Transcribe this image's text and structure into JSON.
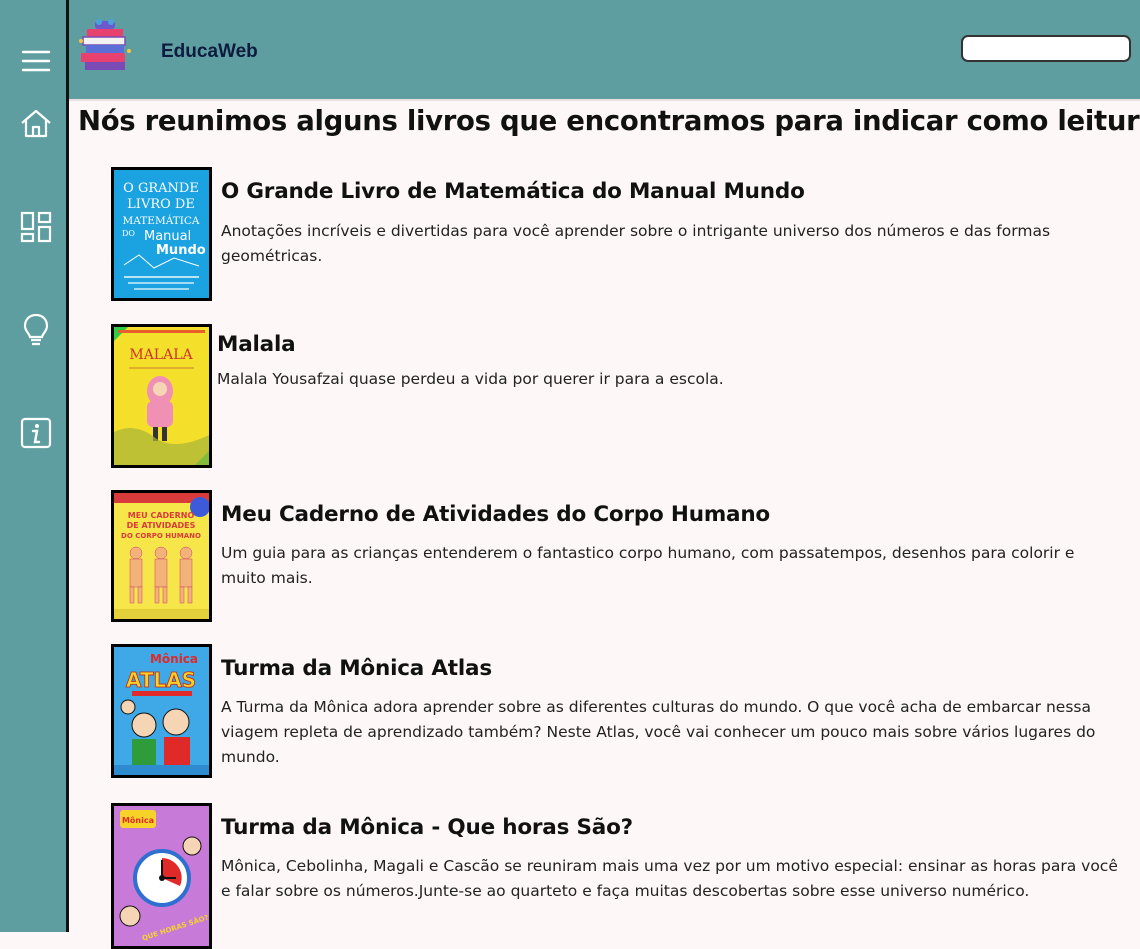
{
  "app": {
    "brand": "EducaWeb",
    "search_placeholder": "",
    "colors": {
      "sidebar": "#5f9ea0",
      "header": "#5f9ea0",
      "background": "#fdf8f7"
    }
  },
  "sidebar": {
    "items": [
      {
        "icon": "menu-icon"
      },
      {
        "icon": "home-icon"
      },
      {
        "icon": "dashboard-icon"
      },
      {
        "icon": "lightbulb-icon"
      },
      {
        "icon": "info-icon"
      }
    ]
  },
  "main": {
    "heading": "Nós reunimos alguns livros que encontramos para indicar como leitura:",
    "books": [
      {
        "title": "O Grande Livro de Matemática do Manual Mundo",
        "description": "Anotações incríveis e divertidas para você aprender sobre o intrigante universo dos números e das formas geométricas.",
        "cover_text": [
          "O GRANDE",
          "LIVRO DE",
          "MATEMÁTICA",
          "DO",
          "Manual",
          "Mundo"
        ],
        "cover_color": "#1aa3e0"
      },
      {
        "title": "Malala",
        "description": "Malala Yousafzai quase perdeu a vida por querer ir para a escola.",
        "cover_text": [
          "MALALA"
        ],
        "cover_color": "#f4e02a"
      },
      {
        "title": "Meu Caderno de Atividades do Corpo Humano",
        "description": "Um guia para as crianças entenderem o fantastico corpo humano, com passatempos, desenhos para colorir e muito mais.",
        "cover_text": [
          "MEU CADERNO",
          "DE ATIVIDADES",
          "DO CORPO HUMANO"
        ],
        "cover_color": "#f7e64a"
      },
      {
        "title": "Turma da Mônica Atlas",
        "description": "A Turma da Mônica adora aprender sobre as diferentes culturas do mundo. O que você acha de embarcar nessa viagem repleta de aprendizado também? Neste Atlas, você vai conhecer um pouco mais sobre vários lugares do mundo.",
        "cover_text": [
          "Mônica",
          "ATLAS"
        ],
        "cover_color": "#3fa8e6"
      },
      {
        "title": "Turma da Mônica - Que horas São?",
        "description": "Mônica, Cebolinha, Magali e Cascão se reuniram mais uma vez por um motivo especial: ensinar as horas para você e falar sobre os números.Junte-se ao quarteto e faça muitas descobertas sobre esse universo numérico.",
        "cover_text": [
          "Mônica",
          "QUE HORAS SÃO?"
        ],
        "cover_color": "#c77ad8"
      }
    ]
  }
}
